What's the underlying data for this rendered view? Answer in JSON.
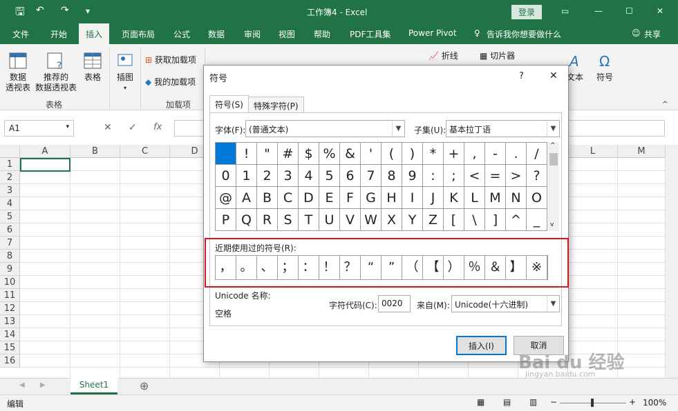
{
  "window": {
    "title": "工作簿4 - Excel",
    "login": "登录"
  },
  "ribbon_tabs": [
    "文件",
    "开始",
    "插入",
    "页面布局",
    "公式",
    "数据",
    "审阅",
    "视图",
    "帮助",
    "PDF工具集",
    "Power Pivot",
    "告诉我你想要做什么",
    "共享"
  ],
  "ribbon": {
    "pivot": "数据\n透视表",
    "rec_pivot": "推荐的\n数据透视表",
    "table": "表格",
    "group_table": "表格",
    "illustrations": "插图",
    "get_addins": "获取加载项",
    "my_addins": "我的加载项",
    "group_addins": "加载项",
    "sparkline": "折线",
    "slicer": "切片器",
    "text": "文本",
    "symbol": "符号"
  },
  "formula": {
    "namebox": "A1",
    "fx": "fx"
  },
  "grid": {
    "columns": [
      "A",
      "B",
      "C",
      "D",
      "",
      "",
      "",
      "",
      "",
      "",
      "",
      "L",
      "M"
    ],
    "rows": [
      "1",
      "2",
      "3",
      "4",
      "5",
      "6",
      "7",
      "8",
      "9",
      "10",
      "11",
      "12",
      "13",
      "14",
      "15",
      "16"
    ]
  },
  "sheet": {
    "tab": "Sheet1"
  },
  "status": {
    "mode": "编辑",
    "zoom": "100%"
  },
  "dialog": {
    "title": "符号",
    "help": "?",
    "close": "✕",
    "tab1": "符号(S)",
    "tab2": "特殊字符(P)",
    "font_label": "字体(F):",
    "font_value": "(普通文本)",
    "subset_label": "子集(U):",
    "subset_value": "基本拉丁语",
    "symbols": [
      " ",
      "!",
      "\"",
      "#",
      "$",
      "%",
      "&",
      "'",
      "(",
      ")",
      "*",
      "+",
      ",",
      "-",
      ".",
      "/",
      "0",
      "1",
      "2",
      "3",
      "4",
      "5",
      "6",
      "7",
      "8",
      "9",
      ":",
      ";",
      "<",
      "=",
      ">",
      "?",
      "@",
      "A",
      "B",
      "C",
      "D",
      "E",
      "F",
      "G",
      "H",
      "I",
      "J",
      "K",
      "L",
      "M",
      "N",
      "O",
      "P",
      "Q",
      "R",
      "S",
      "T",
      "U",
      "V",
      "W",
      "X",
      "Y",
      "Z",
      "[",
      "\\",
      "]",
      "^",
      "_"
    ],
    "recent_label": "近期使用过的符号(R):",
    "recent": [
      "，",
      "。",
      "、",
      "；",
      "：",
      "！",
      "？",
      "“",
      "”",
      "（",
      "【",
      "）",
      "％",
      "＆",
      "】",
      "※"
    ],
    "unicode_name_label": "Unicode 名称:",
    "unicode_name": "空格",
    "charcode_label": "字符代码(C):",
    "charcode": "0020",
    "from_label": "来自(M):",
    "from_value": "Unicode(十六进制)",
    "insert": "插入(I)",
    "cancel": "取消"
  },
  "watermark": {
    "brand": "Bai du 经验",
    "url": "jingyan.baidu.com"
  },
  "colors": {
    "excel_green": "#217346",
    "highlight": "#e0131a",
    "selected": "#0078d7"
  }
}
